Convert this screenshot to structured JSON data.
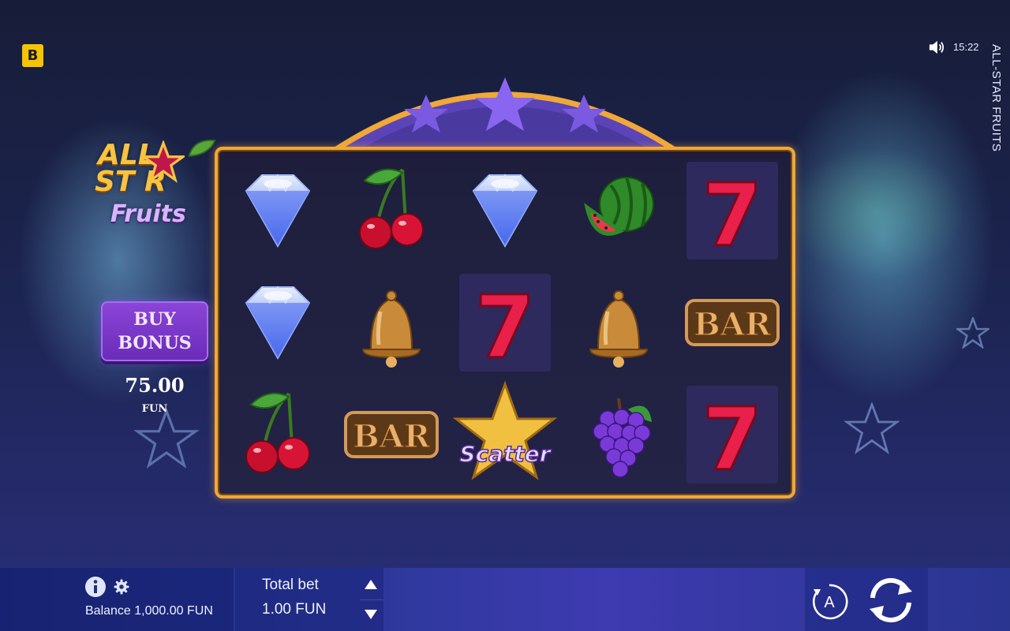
{
  "header": {
    "brand_badge": "B",
    "clock": "15:22",
    "game_title_vertical": "ALL-STAR FRUITS",
    "sound_icon": "speaker-on-icon"
  },
  "logo": {
    "line1": "ALL-",
    "line2": "ST R",
    "line3": "Fruits"
  },
  "buy_bonus": {
    "label": "BUY\nBONUS",
    "price": "75.00",
    "currency": "FUN"
  },
  "reels": {
    "rows": 3,
    "columns": 5,
    "symbols": [
      [
        "diamond",
        "cherry",
        "diamond",
        "watermelon",
        "seven"
      ],
      [
        "diamond",
        "bell",
        "seven",
        "bell",
        "bar"
      ],
      [
        "cherry",
        "bar",
        "scatter",
        "grapes",
        "seven"
      ]
    ],
    "bar_label": "BAR",
    "seven_label": "7",
    "scatter_label": "Scatter"
  },
  "bottom_bar": {
    "balance_label": "Balance 1,000.00 FUN",
    "total_bet_label": "Total bet",
    "total_bet_value": "1.00 FUN",
    "info_icon": "info-icon",
    "settings_icon": "gear-icon",
    "autoplay_label": "A",
    "spin_icon": "spin-icon"
  },
  "colors": {
    "frame_gold": "#f0a838",
    "bonus_purple": "#7a3acb",
    "brand_yellow": "#f5c400"
  }
}
